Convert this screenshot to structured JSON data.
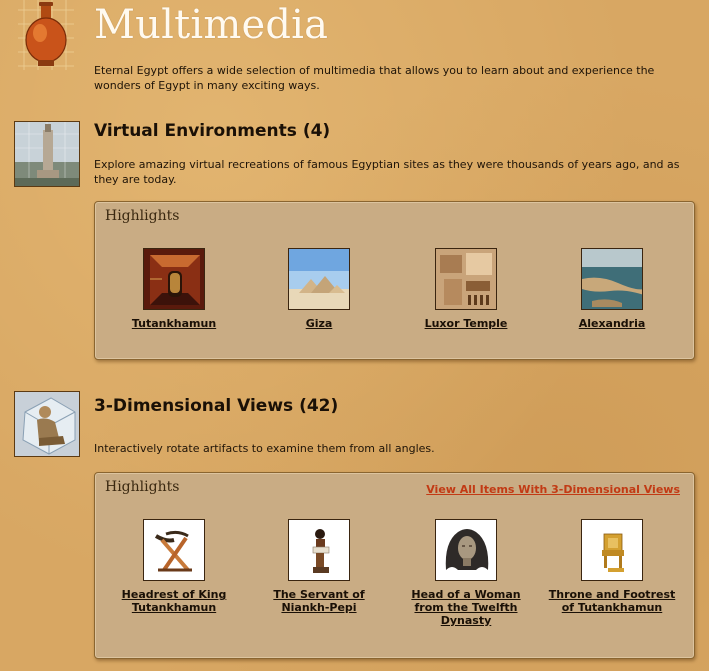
{
  "header": {
    "icon": "lantern-vase-icon",
    "title": "Multimedia",
    "intro": "Eternal Egypt offers a wide selection of multimedia that allows you to learn about and experience the wonders of Egypt in many exciting ways."
  },
  "sections": [
    {
      "icon": "lighthouse-thumbnail",
      "title": "Virtual Environments (4)",
      "description": "Explore amazing virtual recreations of famous Egyptian sites as they were thousands of years ago, and as they are today.",
      "highlights_title": "Highlights",
      "view_all": "",
      "items": [
        {
          "label": "Tutankhamun",
          "icon": "tomb-interior-thumbnail"
        },
        {
          "label": "Giza",
          "icon": "pyramids-thumbnail"
        },
        {
          "label": "Luxor Temple",
          "icon": "temple-aerial-thumbnail"
        },
        {
          "label": "Alexandria",
          "icon": "coastline-thumbnail"
        }
      ]
    },
    {
      "icon": "statue-3d-thumbnail",
      "title": "3-Dimensional Views (42)",
      "description": "Interactively rotate artifacts to examine them from all angles.",
      "highlights_title": "Highlights",
      "view_all": "View All Items With 3-Dimensional Views",
      "items": [
        {
          "label": "Headrest of King Tutankhamun",
          "icon": "headrest-thumbnail"
        },
        {
          "label": "The Servant of Niankh-Pepi",
          "icon": "servant-statue-thumbnail"
        },
        {
          "label": "Head of a Woman from the Twelfth Dynasty",
          "icon": "woman-head-thumbnail"
        },
        {
          "label": "Throne and Footrest of Tutankhamun",
          "icon": "throne-thumbnail"
        }
      ]
    }
  ]
}
